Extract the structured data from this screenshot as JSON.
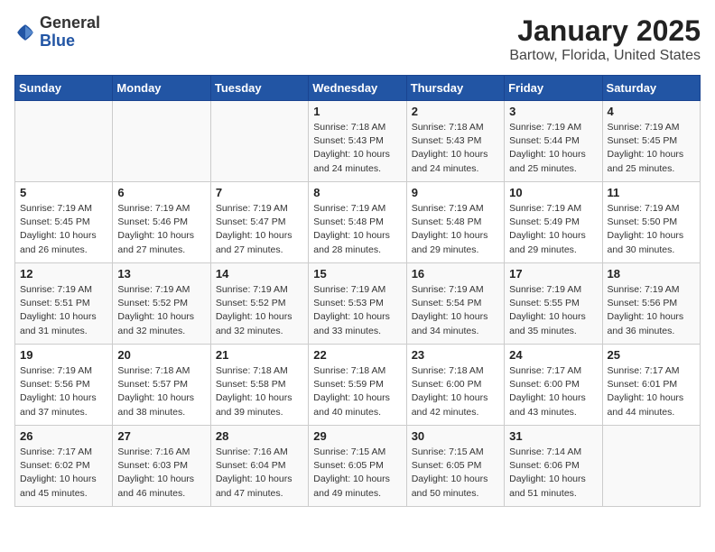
{
  "header": {
    "logo_general": "General",
    "logo_blue": "Blue",
    "title": "January 2025",
    "subtitle": "Bartow, Florida, United States"
  },
  "days_of_week": [
    "Sunday",
    "Monday",
    "Tuesday",
    "Wednesday",
    "Thursday",
    "Friday",
    "Saturday"
  ],
  "weeks": [
    [
      {
        "day": "",
        "info": ""
      },
      {
        "day": "",
        "info": ""
      },
      {
        "day": "",
        "info": ""
      },
      {
        "day": "1",
        "info": "Sunrise: 7:18 AM\nSunset: 5:43 PM\nDaylight: 10 hours\nand 24 minutes."
      },
      {
        "day": "2",
        "info": "Sunrise: 7:18 AM\nSunset: 5:43 PM\nDaylight: 10 hours\nand 24 minutes."
      },
      {
        "day": "3",
        "info": "Sunrise: 7:19 AM\nSunset: 5:44 PM\nDaylight: 10 hours\nand 25 minutes."
      },
      {
        "day": "4",
        "info": "Sunrise: 7:19 AM\nSunset: 5:45 PM\nDaylight: 10 hours\nand 25 minutes."
      }
    ],
    [
      {
        "day": "5",
        "info": "Sunrise: 7:19 AM\nSunset: 5:45 PM\nDaylight: 10 hours\nand 26 minutes."
      },
      {
        "day": "6",
        "info": "Sunrise: 7:19 AM\nSunset: 5:46 PM\nDaylight: 10 hours\nand 27 minutes."
      },
      {
        "day": "7",
        "info": "Sunrise: 7:19 AM\nSunset: 5:47 PM\nDaylight: 10 hours\nand 27 minutes."
      },
      {
        "day": "8",
        "info": "Sunrise: 7:19 AM\nSunset: 5:48 PM\nDaylight: 10 hours\nand 28 minutes."
      },
      {
        "day": "9",
        "info": "Sunrise: 7:19 AM\nSunset: 5:48 PM\nDaylight: 10 hours\nand 29 minutes."
      },
      {
        "day": "10",
        "info": "Sunrise: 7:19 AM\nSunset: 5:49 PM\nDaylight: 10 hours\nand 29 minutes."
      },
      {
        "day": "11",
        "info": "Sunrise: 7:19 AM\nSunset: 5:50 PM\nDaylight: 10 hours\nand 30 minutes."
      }
    ],
    [
      {
        "day": "12",
        "info": "Sunrise: 7:19 AM\nSunset: 5:51 PM\nDaylight: 10 hours\nand 31 minutes."
      },
      {
        "day": "13",
        "info": "Sunrise: 7:19 AM\nSunset: 5:52 PM\nDaylight: 10 hours\nand 32 minutes."
      },
      {
        "day": "14",
        "info": "Sunrise: 7:19 AM\nSunset: 5:52 PM\nDaylight: 10 hours\nand 32 minutes."
      },
      {
        "day": "15",
        "info": "Sunrise: 7:19 AM\nSunset: 5:53 PM\nDaylight: 10 hours\nand 33 minutes."
      },
      {
        "day": "16",
        "info": "Sunrise: 7:19 AM\nSunset: 5:54 PM\nDaylight: 10 hours\nand 34 minutes."
      },
      {
        "day": "17",
        "info": "Sunrise: 7:19 AM\nSunset: 5:55 PM\nDaylight: 10 hours\nand 35 minutes."
      },
      {
        "day": "18",
        "info": "Sunrise: 7:19 AM\nSunset: 5:56 PM\nDaylight: 10 hours\nand 36 minutes."
      }
    ],
    [
      {
        "day": "19",
        "info": "Sunrise: 7:19 AM\nSunset: 5:56 PM\nDaylight: 10 hours\nand 37 minutes."
      },
      {
        "day": "20",
        "info": "Sunrise: 7:18 AM\nSunset: 5:57 PM\nDaylight: 10 hours\nand 38 minutes."
      },
      {
        "day": "21",
        "info": "Sunrise: 7:18 AM\nSunset: 5:58 PM\nDaylight: 10 hours\nand 39 minutes."
      },
      {
        "day": "22",
        "info": "Sunrise: 7:18 AM\nSunset: 5:59 PM\nDaylight: 10 hours\nand 40 minutes."
      },
      {
        "day": "23",
        "info": "Sunrise: 7:18 AM\nSunset: 6:00 PM\nDaylight: 10 hours\nand 42 minutes."
      },
      {
        "day": "24",
        "info": "Sunrise: 7:17 AM\nSunset: 6:00 PM\nDaylight: 10 hours\nand 43 minutes."
      },
      {
        "day": "25",
        "info": "Sunrise: 7:17 AM\nSunset: 6:01 PM\nDaylight: 10 hours\nand 44 minutes."
      }
    ],
    [
      {
        "day": "26",
        "info": "Sunrise: 7:17 AM\nSunset: 6:02 PM\nDaylight: 10 hours\nand 45 minutes."
      },
      {
        "day": "27",
        "info": "Sunrise: 7:16 AM\nSunset: 6:03 PM\nDaylight: 10 hours\nand 46 minutes."
      },
      {
        "day": "28",
        "info": "Sunrise: 7:16 AM\nSunset: 6:04 PM\nDaylight: 10 hours\nand 47 minutes."
      },
      {
        "day": "29",
        "info": "Sunrise: 7:15 AM\nSunset: 6:05 PM\nDaylight: 10 hours\nand 49 minutes."
      },
      {
        "day": "30",
        "info": "Sunrise: 7:15 AM\nSunset: 6:05 PM\nDaylight: 10 hours\nand 50 minutes."
      },
      {
        "day": "31",
        "info": "Sunrise: 7:14 AM\nSunset: 6:06 PM\nDaylight: 10 hours\nand 51 minutes."
      },
      {
        "day": "",
        "info": ""
      }
    ]
  ]
}
